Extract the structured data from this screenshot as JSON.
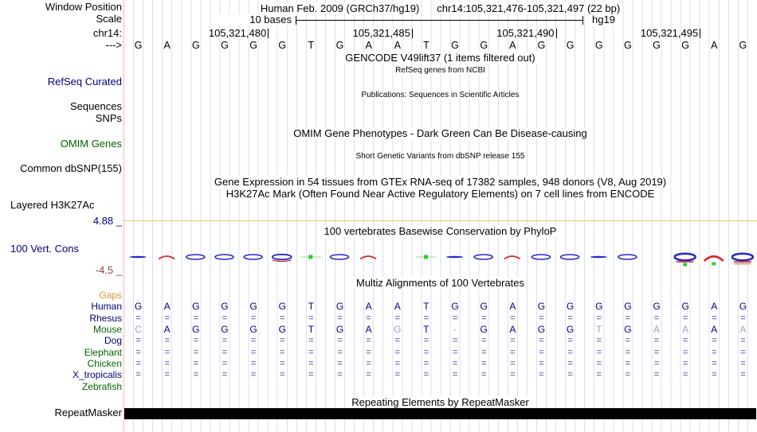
{
  "header": {
    "labels": {
      "window_position": "Window Position",
      "scale": "Scale",
      "chromosome": "chr14:",
      "strand_arrow": "--->"
    },
    "assembly_title": "Human Feb. 2009 (GRCh37/hg19)",
    "position_title": "chr14:105,321,476-105,321,497 (22 bp)",
    "scale_bar": {
      "label": "10 bases",
      "assembly": "hg19"
    },
    "coordinates": [
      {
        "label": "105,321,480",
        "base": 5
      },
      {
        "label": "105,321,485",
        "base": 10
      },
      {
        "label": "105,321,490",
        "base": 15
      },
      {
        "label": "105,321,495",
        "base": 20
      }
    ],
    "sequence": "GAGGGGTGAATGGAGGGGGGAG"
  },
  "tracks": {
    "gencode": {
      "center": "GENCODE V49lift37 (1 items filtered out)"
    },
    "refseq": {
      "label": "RefSeq Curated",
      "center": "RefSeq genes from NCBI"
    },
    "sequences": {
      "label": "Sequences"
    },
    "snps": {
      "label": "SNPs"
    },
    "publications": {
      "center": "Publications: Sequences in Scientific Articles"
    },
    "omim": {
      "label": "OMIM Genes",
      "center": "OMIM Gene Phenotypes - Dark Green Can Be Disease-causing"
    },
    "dbsnp": {
      "label": "Common dbSNP(155)",
      "center": "Short Genetic Variants from dbSNP release 155"
    },
    "gtex": {
      "center": "Gene Expression in 54 tissues from GTEx RNA-seq of 17382 samples, 948 donors (V8, Aug 2019)"
    },
    "h3k27ac": {
      "label": "Layered H3K27Ac",
      "center": "H3K27Ac Mark (Often Found Near Active Regulatory Elements) on 7 cell lines from ENCODE"
    },
    "conservation": {
      "label": "100 Vert. Cons",
      "max_label": "4.88 _",
      "min_label": "-4.5 _",
      "center": "100 vertebrates Basewise Conservation by PhyloP",
      "glyphs": [
        "blue-dash",
        "red-arc",
        "blue-lens",
        "blue-lens",
        "blue-lens",
        "blue-lens-red",
        "green-dot",
        "blue-lens",
        "red-arc",
        "blank",
        "green-dot",
        "blue-dash",
        "blue-lens",
        "red-arc",
        "blue-lens",
        "blue-lens",
        "blue-dash",
        "blue-lens",
        "blank",
        "blue-oval-red-green",
        "red-arc-green",
        "blue-oval-tan"
      ]
    },
    "multiz": {
      "center": "Multiz Alignments of 100 Vertebrates",
      "rows": [
        {
          "id": "gaps",
          "label": "Gaps",
          "label_color": "#e2922e",
          "type": "empty"
        },
        {
          "id": "human",
          "label": "Human",
          "label_color": "#000080",
          "type": "letters",
          "seq": "GAGGGGTGAATGGAGGGGGGAG",
          "light": []
        },
        {
          "id": "rhesus",
          "label": "Rhesus",
          "label_color": "#000080",
          "type": "equals"
        },
        {
          "id": "mouse",
          "label": "Mouse",
          "label_color": "#006400",
          "type": "letters",
          "seq": "CAGGGGTGAGT-GAGGTGAAAA",
          "light": [
            0,
            9,
            11,
            16,
            18,
            19,
            21
          ]
        },
        {
          "id": "dog",
          "label": "Dog",
          "label_color": "#000080",
          "type": "equals"
        },
        {
          "id": "elephant",
          "label": "Elephant",
          "label_color": "#006400",
          "type": "equals"
        },
        {
          "id": "chicken",
          "label": "Chicken",
          "label_color": "#006400",
          "type": "equals"
        },
        {
          "id": "x_tropicalis",
          "label": "X_tropicalis",
          "label_color": "#000080",
          "type": "equals"
        },
        {
          "id": "zebrafish",
          "label": "Zebrafish",
          "label_color": "#006400",
          "type": "empty"
        }
      ]
    },
    "repeatmasker": {
      "label": "RepeatMasker",
      "center": "Repeating Elements by RepeatMasker"
    }
  },
  "colors": {
    "grid_line": "#dcdcf2",
    "track_border_pink": "#ffb3b3",
    "h3k27ac_baseline_yellow": "#f3c163",
    "navy_label": "#000080",
    "green_label": "#006400",
    "orange_label": "#e2922e",
    "center_title_blue": "#3d3dbe",
    "min_label_maroon": "#8e4040",
    "equals_glyph": "#8484bd",
    "light_letter": "#98a0cc",
    "wiggle_blue": "#2929c8",
    "wiggle_red": "#d42a2a",
    "wiggle_green": "#2fcc2f",
    "wiggle_light_green": "#b8e6b8",
    "wiggle_tan": "#d2a679",
    "repeat_bar": "#000000"
  }
}
